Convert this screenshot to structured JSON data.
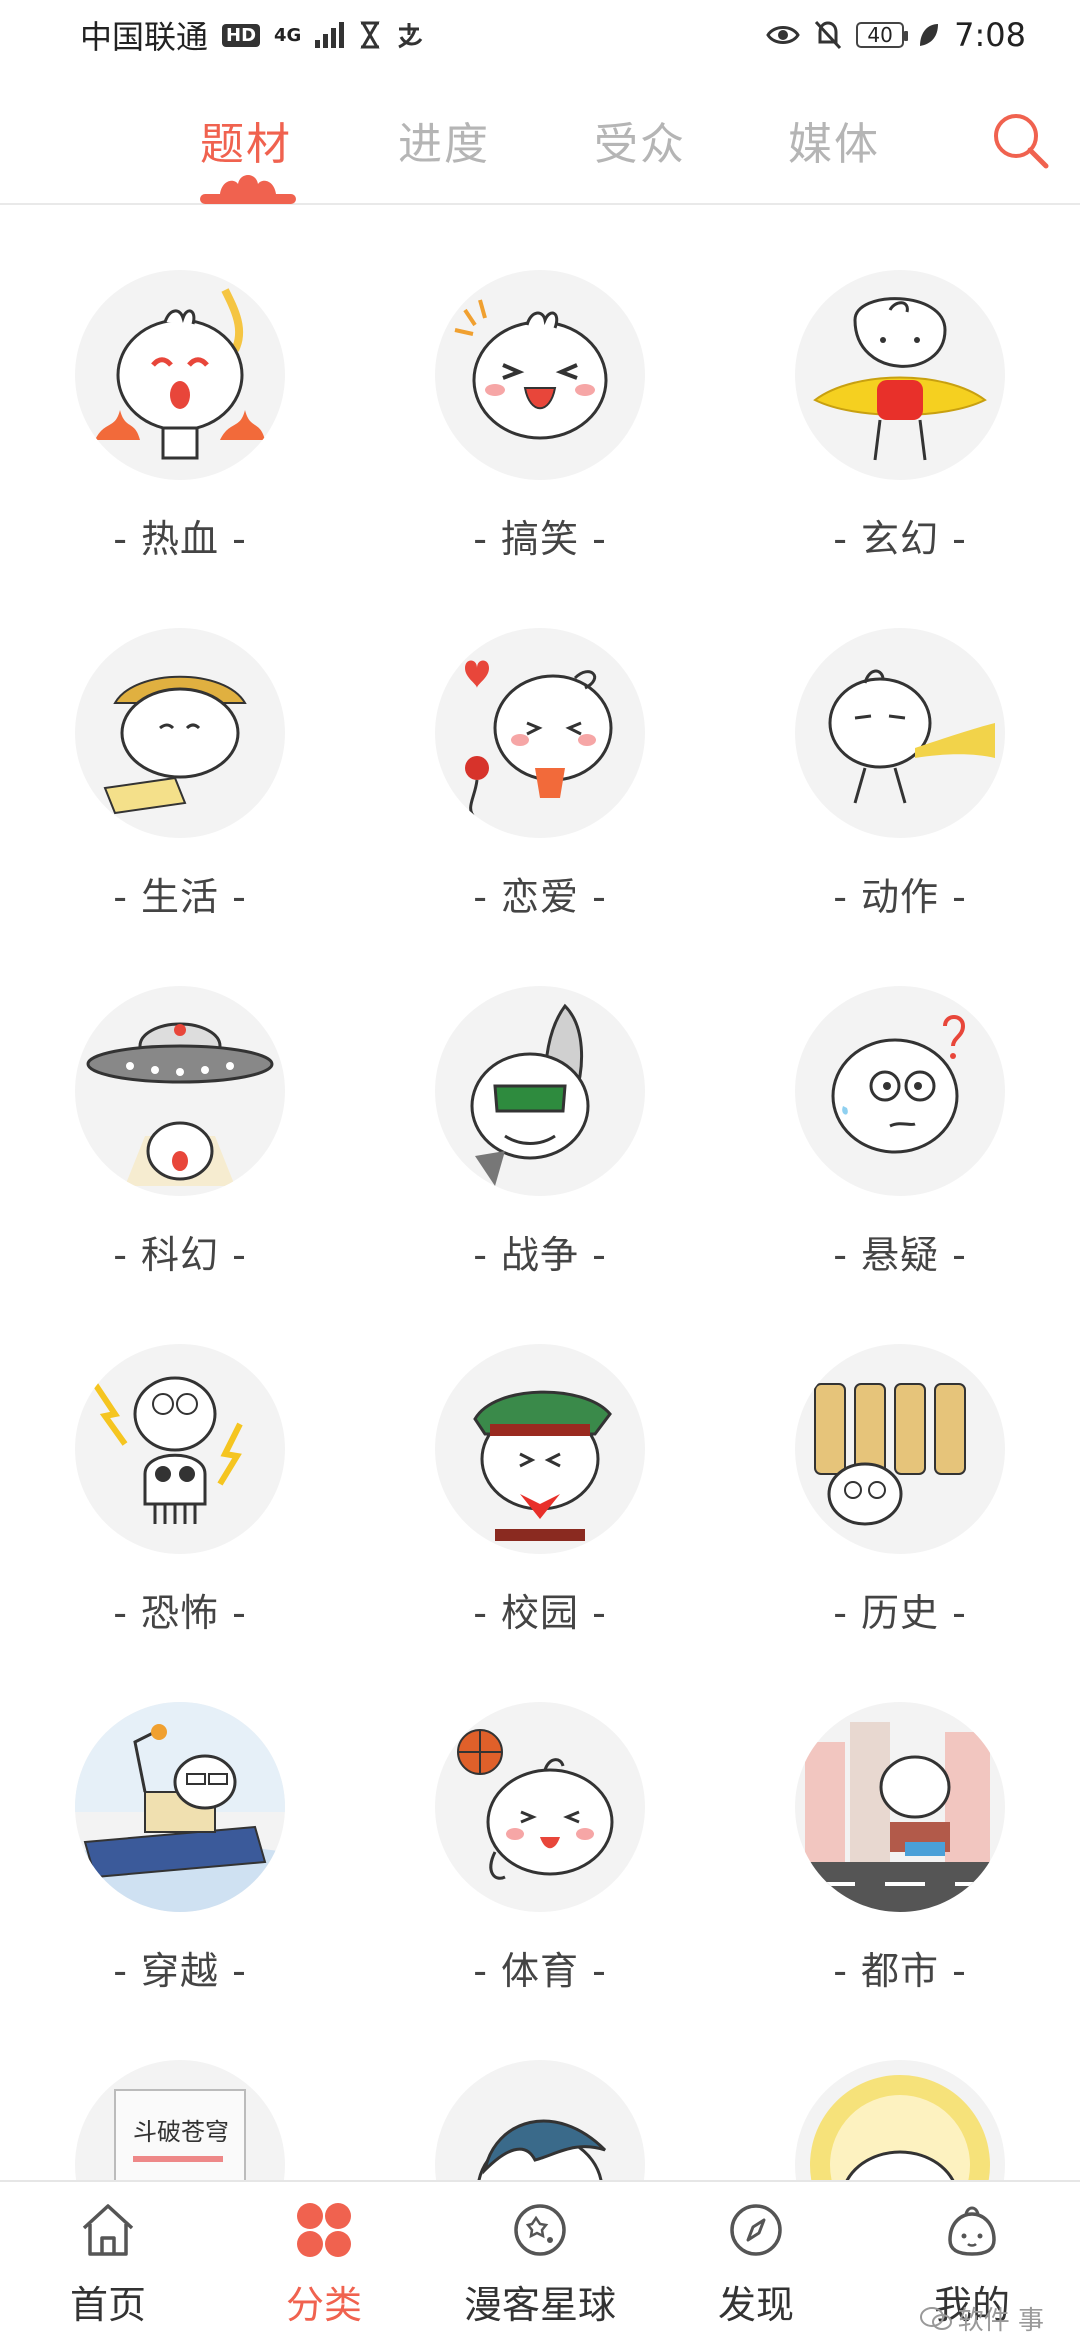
{
  "status_bar": {
    "carrier": "中国联通",
    "hd": "HD",
    "network": "4G",
    "battery": "40",
    "time": "7:08"
  },
  "tabs": [
    {
      "label": "题材",
      "active": true
    },
    {
      "label": "进度",
      "active": false
    },
    {
      "label": "受众",
      "active": false
    },
    {
      "label": "媒体",
      "active": false
    }
  ],
  "categories": [
    {
      "label": "- 热血 -",
      "icon": "fire-mascot-icon"
    },
    {
      "label": "- 搞笑 -",
      "icon": "laughing-mascot-icon"
    },
    {
      "label": "- 玄幻 -",
      "icon": "fantasy-mascot-icon"
    },
    {
      "label": "- 生活 -",
      "icon": "life-mascot-icon"
    },
    {
      "label": "- 恋爱 -",
      "icon": "love-mascot-icon"
    },
    {
      "label": "- 动作 -",
      "icon": "action-mascot-icon"
    },
    {
      "label": "- 科幻 -",
      "icon": "ufo-mascot-icon"
    },
    {
      "label": "- 战争 -",
      "icon": "war-mascot-icon"
    },
    {
      "label": "- 悬疑 -",
      "icon": "mystery-mascot-icon"
    },
    {
      "label": "- 恐怖 -",
      "icon": "horror-mascot-icon"
    },
    {
      "label": "- 校园 -",
      "icon": "school-mascot-icon"
    },
    {
      "label": "- 历史 -",
      "icon": "history-mascot-icon"
    },
    {
      "label": "- 穿越 -",
      "icon": "time-travel-mascot-icon"
    },
    {
      "label": "- 体育 -",
      "icon": "sports-mascot-icon"
    },
    {
      "label": "- 都市 -",
      "icon": "city-mascot-icon"
    },
    {
      "label": "",
      "icon": "book-mascot-icon",
      "book_text": "斗破苍穹"
    },
    {
      "label": "",
      "icon": "hair-mascot-icon"
    },
    {
      "label": "",
      "icon": "halo-mascot-icon"
    }
  ],
  "bottom_nav": [
    {
      "label": "首页",
      "icon": "home-icon",
      "active": false
    },
    {
      "label": "分类",
      "icon": "category-icon",
      "active": true
    },
    {
      "label": "漫客星球",
      "icon": "planet-icon",
      "active": false
    },
    {
      "label": "发现",
      "icon": "compass-icon",
      "active": false
    },
    {
      "label": "我的",
      "icon": "profile-mascot-icon",
      "active": false
    }
  ],
  "watermark": "软件 事",
  "colors": {
    "accent": "#f0624f",
    "inactive_tab": "#b5b5b5",
    "avatar_bg": "#f3f3f3"
  }
}
